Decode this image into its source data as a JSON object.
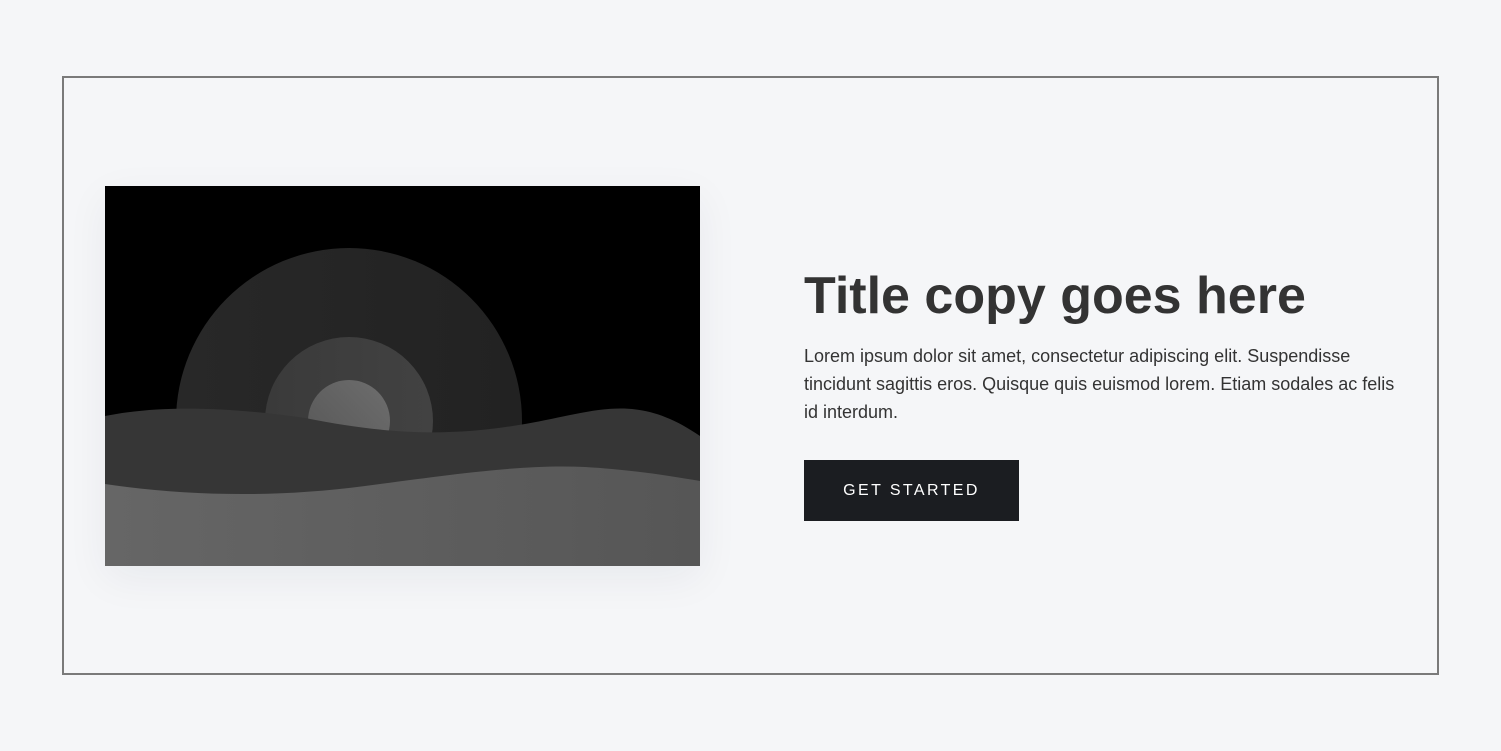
{
  "hero": {
    "image": {
      "icon": "landscape-illustration",
      "colors": {
        "sky": "#000000",
        "sun_outer": "#262626",
        "sun_middle": "#3c3c3c",
        "sun_inner": "#666666",
        "hill_back": "#363636",
        "hill_front": "#5e5e5e"
      }
    },
    "title": "Title copy goes here",
    "body": "Lorem ipsum dolor sit amet, consectetur adipiscing elit. Suspendisse tincidunt sagittis eros. Quisque quis euismod lorem. Etiam sodales ac felis id interdum.",
    "cta_label": "GET STARTED"
  },
  "colors": {
    "page_background": "#f5f6f8",
    "border": "#7a7a7a",
    "text": "#333333",
    "button_background": "#1b1d21",
    "button_text": "#ffffff"
  }
}
